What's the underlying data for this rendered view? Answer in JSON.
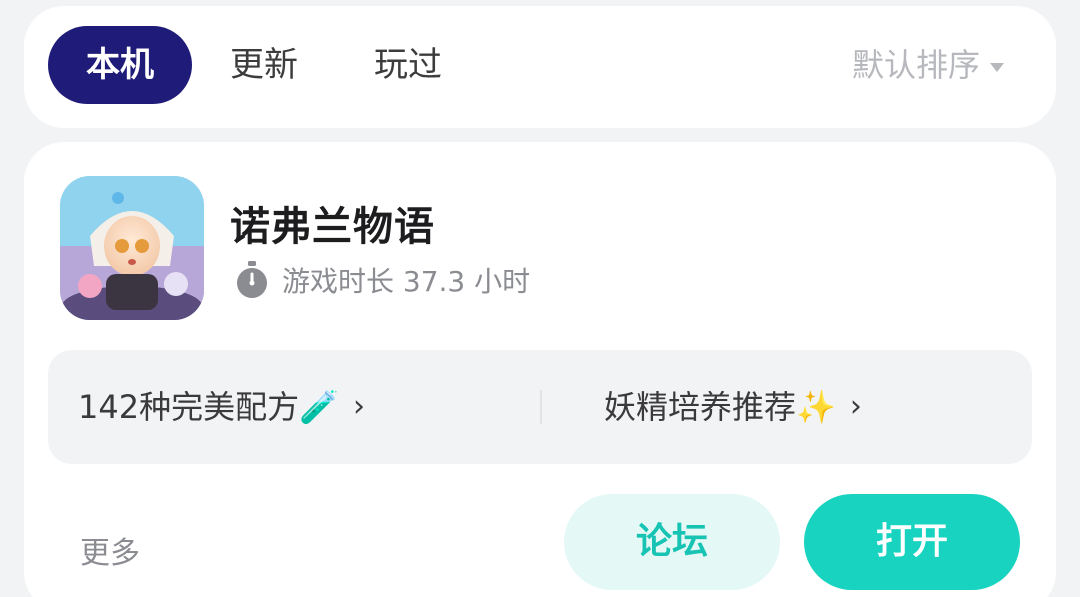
{
  "tabs": [
    {
      "label": "本机",
      "active": true
    },
    {
      "label": "更新",
      "active": false
    },
    {
      "label": "玩过",
      "active": false
    }
  ],
  "sort": {
    "label": "默认排序"
  },
  "game": {
    "title": "诺弗兰物语",
    "playtime": "游戏时长 37.3 小时",
    "tips": [
      {
        "label": "142种完美配方🧪"
      },
      {
        "label": "妖精培养推荐✨"
      }
    ],
    "more_label": "更多",
    "forum_label": "论坛",
    "open_label": "打开"
  },
  "colors": {
    "active_tab": "#1f1b78",
    "open_button": "#18d3bf",
    "forum_button_bg": "#e4f8f6"
  }
}
